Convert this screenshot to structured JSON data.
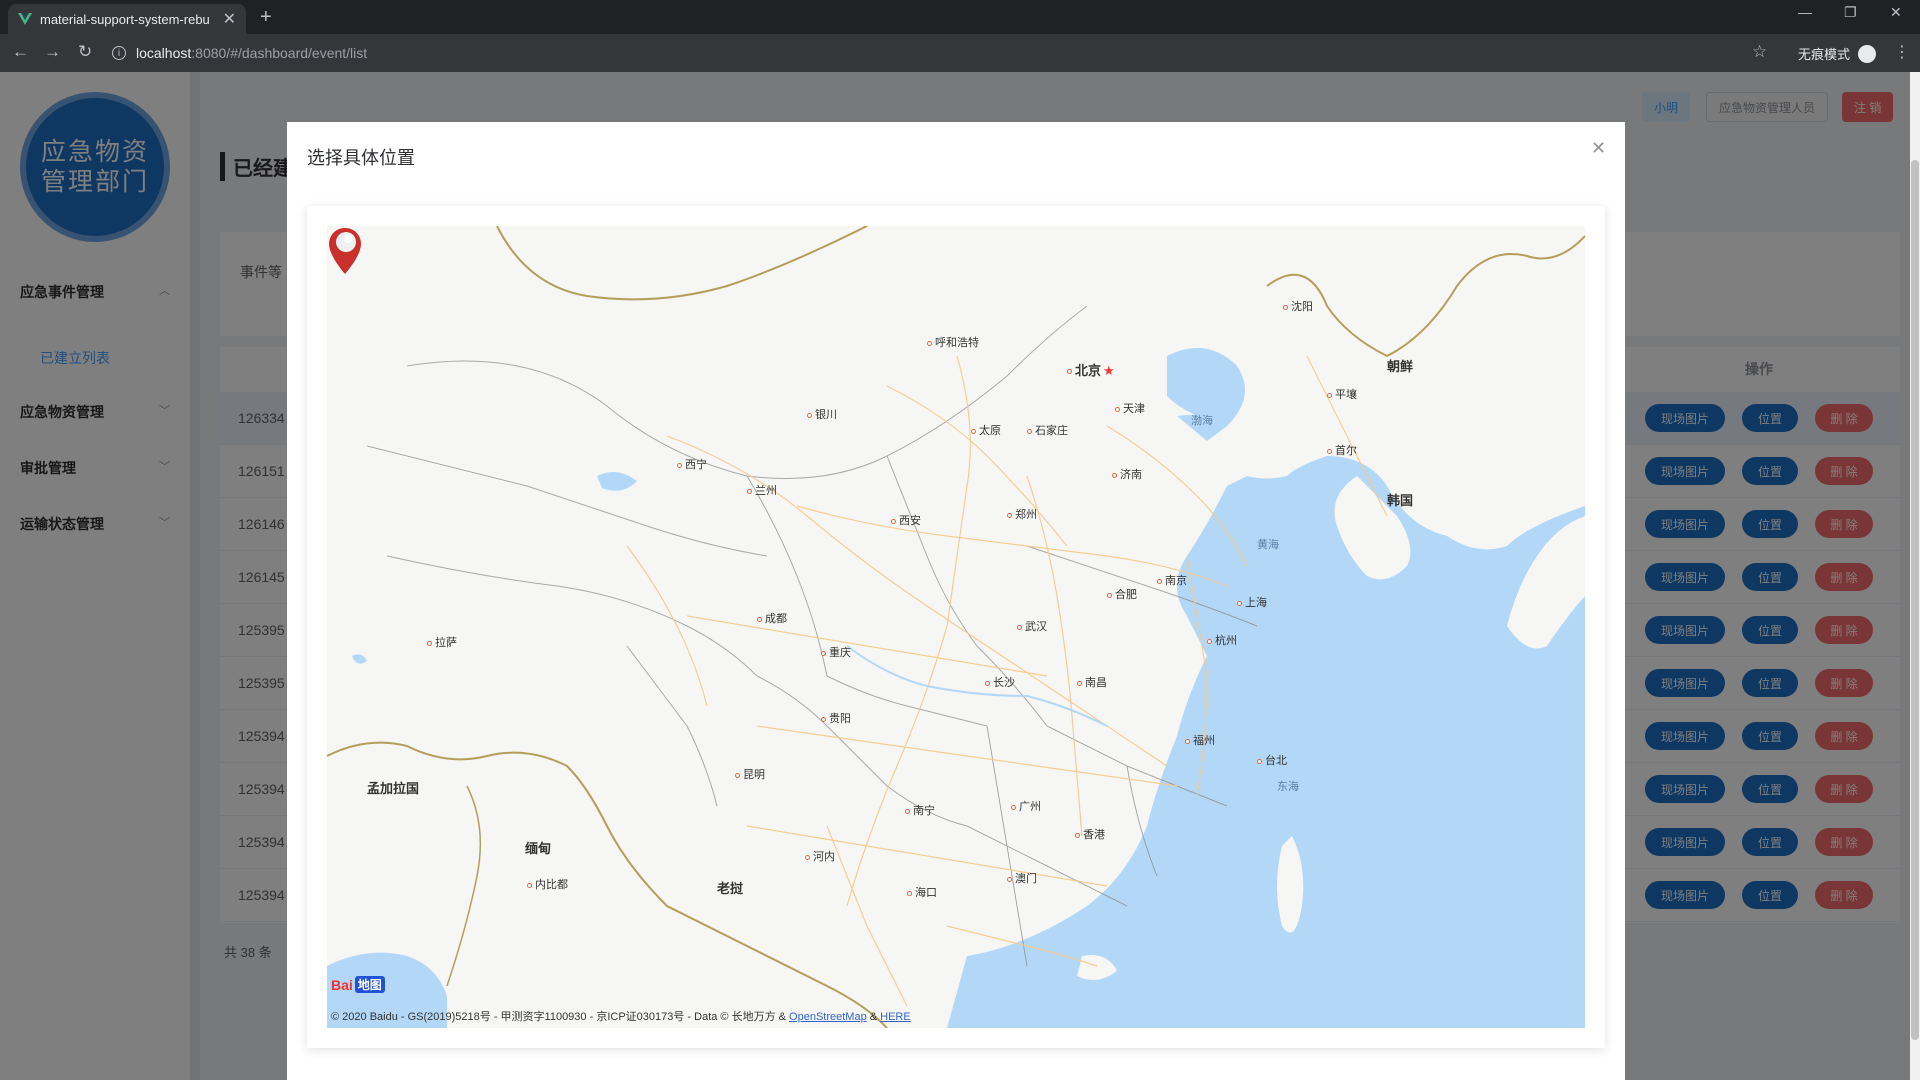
{
  "browser": {
    "tab_title": "material-support-system-rebu",
    "url_host": "localhost",
    "url_rest": ":8080/#/dashboard/event/list",
    "incognito_label": "无痕模式"
  },
  "sidebar": {
    "logo_text": "应急物资管理部门",
    "menu": [
      {
        "label": "应急事件管理"
      },
      {
        "label": "应急物资管理"
      },
      {
        "label": "审批管理"
      },
      {
        "label": "运输状态管理"
      }
    ],
    "submenu_active": "已建立列表"
  },
  "header": {
    "user": "小明",
    "role": "应急物资管理人员",
    "logout": "注 销"
  },
  "page": {
    "title": "已经建",
    "filter_label": "事件等",
    "op_header": "操作",
    "total": "共 38 条",
    "rows": [
      {
        "id": "126334"
      },
      {
        "id": "126151"
      },
      {
        "id": "126146"
      },
      {
        "id": "126145"
      },
      {
        "id": "125395"
      },
      {
        "id": "125395"
      },
      {
        "id": "125394"
      },
      {
        "id": "125394"
      },
      {
        "id": "125394"
      },
      {
        "id": "125394"
      }
    ],
    "btn_photo": "现场图片",
    "btn_loc": "位置",
    "btn_del": "删 除"
  },
  "dialog": {
    "title": "选择具体位置",
    "map": {
      "cities": [
        {
          "name": "呼和浩特"
        },
        {
          "name": "北京"
        },
        {
          "name": "天津"
        },
        {
          "name": "沈阳"
        },
        {
          "name": "朝鲜"
        },
        {
          "name": "平壤"
        },
        {
          "name": "首尔"
        },
        {
          "name": "韩国"
        },
        {
          "name": "银川"
        },
        {
          "name": "太原"
        },
        {
          "name": "石家庄"
        },
        {
          "name": "济南"
        },
        {
          "name": "西宁"
        },
        {
          "name": "兰州"
        },
        {
          "name": "西安"
        },
        {
          "name": "郑州"
        },
        {
          "name": "合肥"
        },
        {
          "name": "南京"
        },
        {
          "name": "上海"
        },
        {
          "name": "杭州"
        },
        {
          "name": "武汉"
        },
        {
          "name": "成都"
        },
        {
          "name": "重庆"
        },
        {
          "name": "长沙"
        },
        {
          "name": "南昌"
        },
        {
          "name": "拉萨"
        },
        {
          "name": "贵阳"
        },
        {
          "name": "福州"
        },
        {
          "name": "台北"
        },
        {
          "name": "昆明"
        },
        {
          "name": "南宁"
        },
        {
          "name": "广州"
        },
        {
          "name": "香港"
        },
        {
          "name": "澳门"
        },
        {
          "name": "孟加拉国"
        },
        {
          "name": "缅甸"
        },
        {
          "name": "河内"
        },
        {
          "name": "内比都"
        },
        {
          "name": "老挝"
        },
        {
          "name": "海口"
        }
      ],
      "seas": [
        {
          "name": "渤海"
        },
        {
          "name": "黄海"
        },
        {
          "name": "东海"
        }
      ],
      "baidu_text": "Bai",
      "baidu_map": "地图",
      "copyright_prefix": "© 2020 Baidu - GS(2019)5218号 - 甲测资字1100930 - 京ICP证030173号 - Data © 长地万方 & ",
      "osm": "OpenStreetMap",
      "amp": " & ",
      "here": "HERE"
    }
  },
  "colors": {
    "primary": "#1d6fc4",
    "danger": "#f56c6c",
    "sea": "#b3d7f7",
    "road": "#f5c98a"
  }
}
